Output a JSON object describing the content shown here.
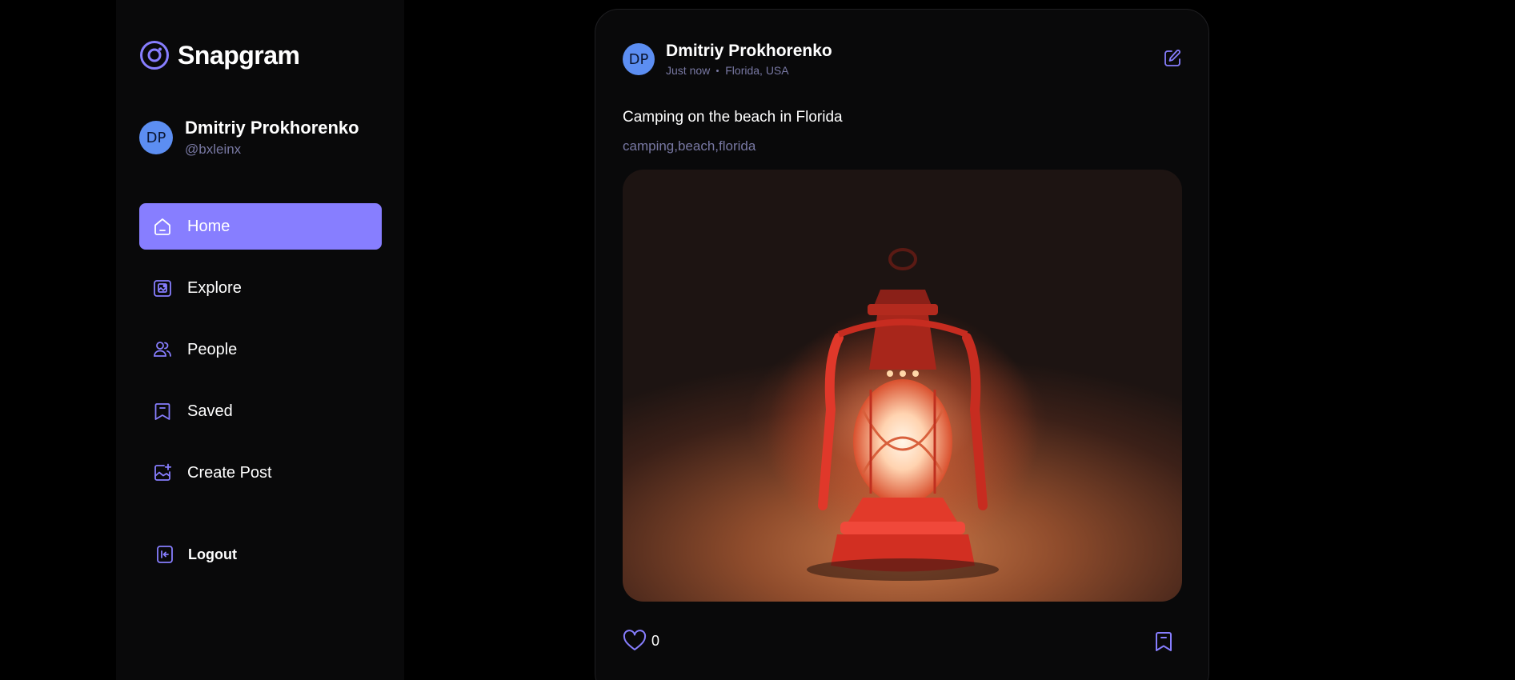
{
  "app": {
    "name": "Snapgram",
    "accent_color": "#877eff",
    "muted_color": "#7878a3"
  },
  "user": {
    "initials": "DP",
    "name": "Dmitriy Prokhorenko",
    "handle": "@bxleinx"
  },
  "nav": {
    "items": [
      {
        "label": "Home",
        "icon": "home-icon",
        "active": true
      },
      {
        "label": "Explore",
        "icon": "explore-icon",
        "active": false
      },
      {
        "label": "People",
        "icon": "people-icon",
        "active": false
      },
      {
        "label": "Saved",
        "icon": "bookmark-icon",
        "active": false
      },
      {
        "label": "Create Post",
        "icon": "create-post-icon",
        "active": false
      }
    ],
    "logout_label": "Logout"
  },
  "post": {
    "author_initials": "DP",
    "author_name": "Dmitriy Prokhorenko",
    "time": "Just now",
    "location": "Florida, USA",
    "caption": "Camping on the beach in Florida",
    "tags": "camping,beach,florida",
    "likes": "0"
  }
}
